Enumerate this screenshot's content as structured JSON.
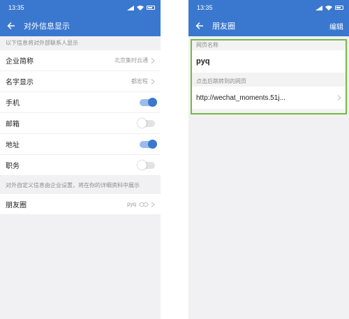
{
  "left": {
    "status_time": "13:35",
    "title": "对外信息显示",
    "hint": "以下信息将对外部联系人显示",
    "rows": [
      {
        "label": "企业简称",
        "value": "北京集时云通",
        "type": "link"
      },
      {
        "label": "名字显示",
        "value": "都宏程",
        "type": "link"
      },
      {
        "label": "手机",
        "toggle": true,
        "type": "toggle"
      },
      {
        "label": "邮箱",
        "toggle": false,
        "type": "toggle"
      },
      {
        "label": "地址",
        "toggle": true,
        "type": "toggle"
      },
      {
        "label": "职务",
        "toggle": false,
        "type": "toggle"
      }
    ],
    "custom_hint": "对外自定义信息由企业设置，将在你的详细资料中展示",
    "moments": {
      "label": "朋友圈",
      "value": "pyq"
    }
  },
  "right": {
    "status_time": "13:35",
    "title": "朋友圈",
    "action": "编辑",
    "name_label": "网页名称",
    "name_value": "pyq",
    "url_label": "点击后跳转到的网页",
    "url_value": "http://wechat_moments.51j..."
  },
  "colors": {
    "accent": "#3a78cf",
    "highlight_border": "#75b843"
  }
}
